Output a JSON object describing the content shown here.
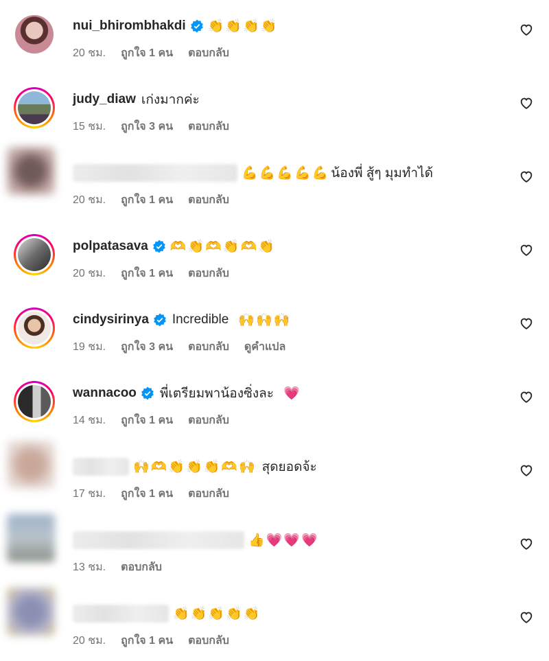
{
  "comments": [
    {
      "username": "nui_bhirombhakdi",
      "verified": true,
      "text": "",
      "emojis": "👏👏👏👏",
      "time": "20 ชม.",
      "likes": "ถูกใจ 1 คน",
      "reply": "ตอบกลับ",
      "translate": ""
    },
    {
      "username": "judy_diaw",
      "verified": false,
      "text": "เก่งมากค่ะ",
      "emojis": "",
      "time": "15 ชม.",
      "likes": "ถูกใจ 3 คน",
      "reply": "ตอบกลับ",
      "translate": ""
    },
    {
      "username": "",
      "verified": false,
      "text": "น้องพี่ สู้ๆ มุมทำได้",
      "emojis": "💪💪💪💪💪",
      "time": "20 ชม.",
      "likes": "ถูกใจ 1 คน",
      "reply": "ตอบกลับ",
      "translate": ""
    },
    {
      "username": "polpatasava",
      "verified": true,
      "text": "",
      "emojis": "🫶👏🫶👏🫶👏",
      "time": "20 ชม.",
      "likes": "ถูกใจ 1 คน",
      "reply": "ตอบกลับ",
      "translate": ""
    },
    {
      "username": "cindysirinya",
      "verified": true,
      "text": "Incredible",
      "emojis": "🙌🙌🙌",
      "time": "19 ชม.",
      "likes": "ถูกใจ 3 คน",
      "reply": "ตอบกลับ",
      "translate": "ดูคำแปล"
    },
    {
      "username": "wannacoo",
      "verified": true,
      "text": "พี่เตรียมพาน้องซิ่งละ",
      "emojis": "💗",
      "time": "14 ชม.",
      "likes": "ถูกใจ 1 คน",
      "reply": "ตอบกลับ",
      "translate": ""
    },
    {
      "username": "",
      "verified": false,
      "text": "สุดยอดจ้ะ",
      "emojis": "🙌🫶👏👏👏🫶🙌",
      "time": "17 ชม.",
      "likes": "ถูกใจ 1 คน",
      "reply": "ตอบกลับ",
      "translate": ""
    },
    {
      "username": "",
      "verified": false,
      "text": "",
      "emojis": "👍💗💗💗",
      "time": "13 ชม.",
      "likes": "",
      "reply": "ตอบกลับ",
      "translate": ""
    },
    {
      "username": "",
      "verified": false,
      "text": "",
      "emojis": "👏👏👏👏👏",
      "time": "20 ชม.",
      "likes": "ถูกใจ 1 คน",
      "reply": "ตอบกลับ",
      "translate": ""
    }
  ],
  "icons": {
    "like": "heart-outline-icon",
    "verified": "verified-badge-icon"
  },
  "colors": {
    "text": "#262626",
    "meta": "#737373",
    "verified": "#0095f6"
  }
}
